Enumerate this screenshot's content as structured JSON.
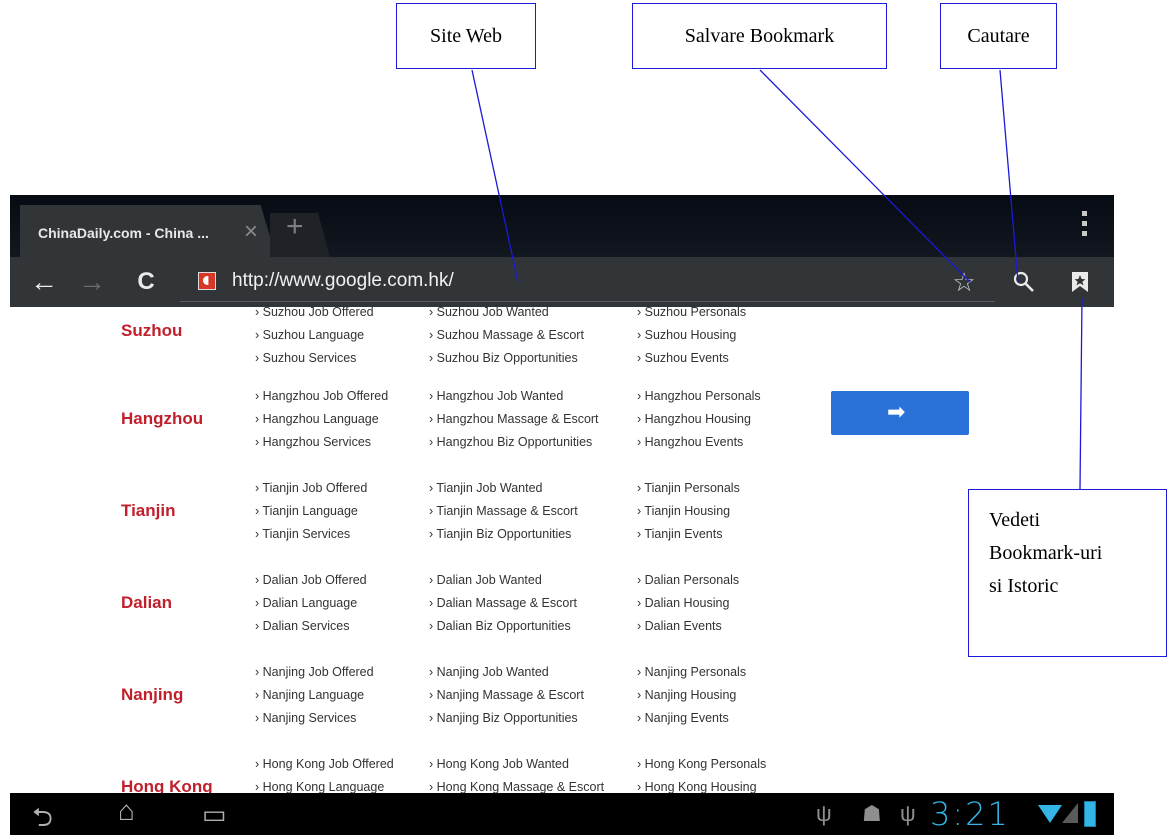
{
  "callouts": {
    "site_web": "Site Web",
    "salvare_bookmark": "Salvare Bookmark",
    "cautare": "Cautare",
    "vedeti_lines": [
      "Vedeti",
      "Bookmark-uri",
      "si Istoric"
    ]
  },
  "browser": {
    "tab_title": "ChinaDaily.com - China ...",
    "tab_close": "×",
    "new_tab": "+",
    "url": "http://www.google.com.hk/",
    "icons": {
      "back": "←",
      "forward": "→",
      "reload": "C",
      "bookmark_star": "☆",
      "search": "⚲",
      "bookmarks": "bookmarks-icon"
    }
  },
  "cities": [
    {
      "name": "Suzhou",
      "col1": [
        "› Suzhou Job Offered",
        "› Suzhou Language",
        "› Suzhou Services"
      ],
      "col2": [
        "› Suzhou Job Wanted",
        "› Suzhou Massage & Escort",
        "› Suzhou Biz Opportunities"
      ],
      "col3": [
        "› Suzhou Personals",
        "› Suzhou Housing",
        "› Suzhou Events"
      ]
    },
    {
      "name": "Hangzhou",
      "col1": [
        "› Hangzhou Job Offered",
        "› Hangzhou Language",
        "› Hangzhou Services"
      ],
      "col2": [
        "› Hangzhou Job Wanted",
        "› Hangzhou Massage & Escort",
        "› Hangzhou Biz Opportunities"
      ],
      "col3": [
        "› Hangzhou Personals",
        "› Hangzhou Housing",
        "› Hangzhou Events"
      ]
    },
    {
      "name": "Tianjin",
      "col1": [
        "› Tianjin Job Offered",
        "› Tianjin Language",
        "› Tianjin Services"
      ],
      "col2": [
        "› Tianjin Job Wanted",
        "› Tianjin Massage & Escort",
        "› Tianjin Biz Opportunities"
      ],
      "col3": [
        "› Tianjin Personals",
        "› Tianjin Housing",
        "› Tianjin Events"
      ]
    },
    {
      "name": "Dalian",
      "col1": [
        "› Dalian Job Offered",
        "› Dalian Language",
        "› Dalian Services"
      ],
      "col2": [
        "› Dalian Job Wanted",
        "› Dalian Massage & Escort",
        "› Dalian Biz Opportunities"
      ],
      "col3": [
        "› Dalian Personals",
        "› Dalian Housing",
        "› Dalian Events"
      ]
    },
    {
      "name": "Nanjing",
      "col1": [
        "› Nanjing Job Offered",
        "› Nanjing Language",
        "› Nanjing Services"
      ],
      "col2": [
        "› Nanjing Job Wanted",
        "› Nanjing Massage & Escort",
        "› Nanjing Biz Opportunities"
      ],
      "col3": [
        "› Nanjing Personals",
        "› Nanjing Housing",
        "› Nanjing Events"
      ]
    },
    {
      "name": "Hong Kong",
      "col1": [
        "› Hong Kong Job Offered",
        "› Hong Kong Language"
      ],
      "col2": [
        "› Hong Kong Job Wanted",
        "› Hong Kong Massage & Escort"
      ],
      "col3": [
        "› Hong Kong Personals",
        "› Hong Kong Housing"
      ]
    }
  ],
  "go_button": "➡",
  "statusbar": {
    "time": "3:21",
    "nav": {
      "back": "⮌",
      "home": "⌂",
      "recent": "▭"
    },
    "usb": "ψ",
    "android": "☗"
  },
  "colors": {
    "city_name": "#c0202c",
    "go_button": "#2a72d8",
    "clock": "#33b5e5",
    "callout_border": "#1a1ad8"
  }
}
